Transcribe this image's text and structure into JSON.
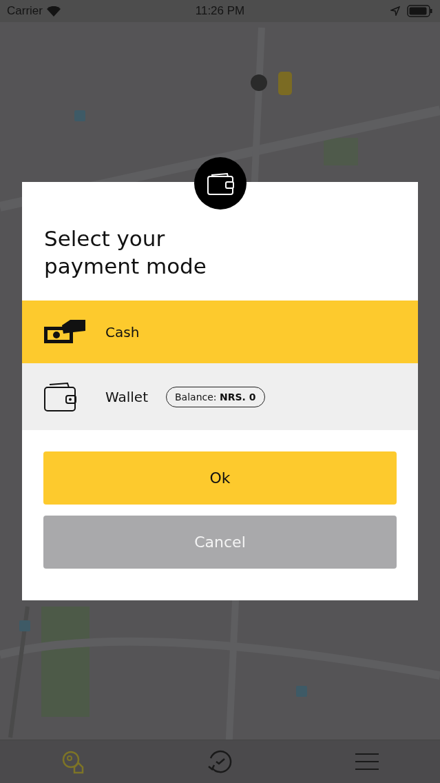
{
  "status_bar": {
    "carrier": "Carrier",
    "time": "11:26 PM"
  },
  "dialog": {
    "title": "Select your payment mode",
    "options": [
      {
        "kind": "cash",
        "label": "Cash",
        "selected": true
      },
      {
        "kind": "wallet",
        "label": "Wallet",
        "selected": false,
        "badge": "Balance: **NRS. 0**"
      }
    ],
    "buttons": [
      {
        "kind": "primary",
        "label": "Ok"
      },
      {
        "kind": "secondary",
        "label": "Cancel"
      }
    ]
  },
  "nav_tabs": [
    {
      "kind": "places",
      "selected": true
    },
    {
      "kind": "history",
      "selected": false
    },
    {
      "kind": "menu",
      "selected": false
    }
  ]
}
